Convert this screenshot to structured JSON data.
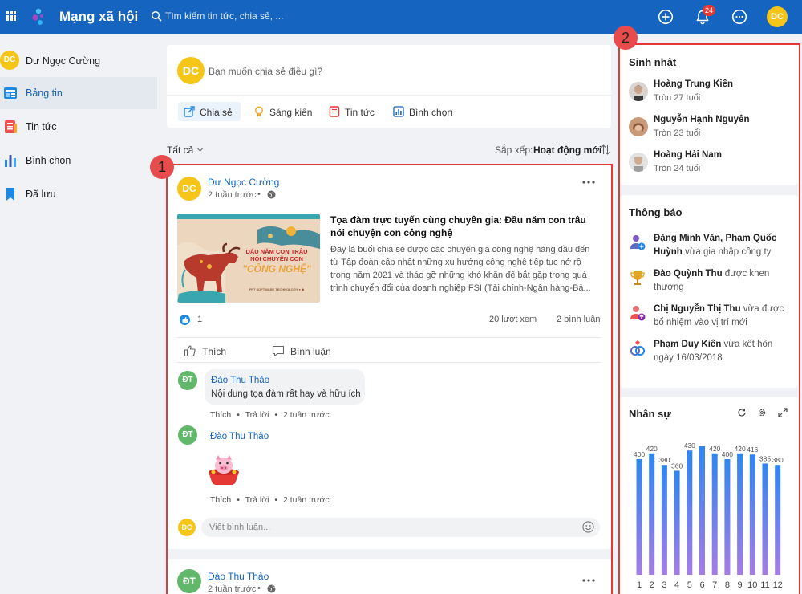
{
  "header": {
    "app_title": "Mạng xã hội",
    "search_placeholder": "Tìm kiếm tin tức, chia sẻ, ...",
    "notification_count": "24",
    "user_initials": "DC",
    "icons": [
      "apps-grid-icon",
      "app-logo-icon",
      "search-icon",
      "add-icon",
      "bell-icon",
      "more-icon"
    ]
  },
  "sidebar": {
    "user": {
      "initials": "DC",
      "name": "Dư Ngọc Cường"
    },
    "items": [
      {
        "label": "Bảng tin",
        "icon": "newsfeed-icon",
        "active": true
      },
      {
        "label": "Tin tức",
        "icon": "news-icon",
        "active": false
      },
      {
        "label": "Bình chọn",
        "icon": "poll-icon",
        "active": false
      },
      {
        "label": "Đã lưu",
        "icon": "bookmark-icon",
        "active": false
      }
    ]
  },
  "composer": {
    "initials": "DC",
    "placeholder": "Bạn muốn chia sẻ điều gì?",
    "actions": [
      {
        "label": "Chia sẻ",
        "icon": "share-icon",
        "active": true
      },
      {
        "label": "Sáng kiến",
        "icon": "idea-icon",
        "active": false
      },
      {
        "label": "Tin tức",
        "icon": "news-icon",
        "active": false
      },
      {
        "label": "Bình chọn",
        "icon": "poll-icon",
        "active": false
      }
    ]
  },
  "filter": {
    "all_label": "Tất cả",
    "sort_label": "Sắp xếp:",
    "sort_value": "Hoạt động mới"
  },
  "callouts": [
    "1",
    "2"
  ],
  "post": {
    "author_initials": "DC",
    "author": "Dư Ngọc Cường",
    "time": "2 tuần trước",
    "dot": "•",
    "article": {
      "image_lines": [
        "DẤU NĂM CON TRÂU",
        "NÓI CHUYỆN CON",
        "\"CÔNG NGHỆ\"",
        "FPT SOFTWARE TECHNOLOGY ● ◆"
      ],
      "title": "Tọa đàm trực tuyến cùng chuyên gia: Đầu năm con trâu nói chuyện con công nghệ",
      "description": "Đây là buổi chia sẻ được các chuyên gia công nghệ hàng đầu đến từ Tập đoàn cập nhật những xu hướng công nghệ tiếp tục nở rộ trong năm 2021 và tháo gỡ những khó khăn để bắt gặp trong quá trình chuyển đổi của doanh nghiệp FSI (Tài chính-Ngân hàng-Bả..."
    },
    "likes": "1",
    "views": "20 lượt xem",
    "comments_count": "2 bình luận",
    "like_label": "Thích",
    "comment_label": "Bình luận",
    "comments": [
      {
        "initials": "ĐT",
        "name": "Đào Thu Thảo",
        "text": "Nội dung tọa đàm rất hay và hữu ích",
        "like": "Thích",
        "reply": "Trả lời",
        "time": "2 tuần trước"
      },
      {
        "initials": "ĐT",
        "name": "Đào Thu Thảo",
        "sticker": "pig-sticker",
        "like": "Thích",
        "reply": "Trả lời",
        "time": "2 tuần trước"
      }
    ],
    "write_initials": "DC",
    "write_placeholder": "Viết bình luận..."
  },
  "post2": {
    "initials": "ĐT",
    "author": "Đào Thu Thảo",
    "time": "2 tuần trước",
    "dot": "•"
  },
  "birthdays": {
    "title": "Sinh nhật",
    "people": [
      {
        "name": "Hoàng Trung Kiên",
        "sub": "Tròn 27 tuổi"
      },
      {
        "name": "Nguyễn Hạnh Nguyên",
        "sub": "Tròn 23 tuổi"
      },
      {
        "name": "Hoàng Hải Nam",
        "sub": "Tròn 24 tuổi"
      }
    ]
  },
  "notices": {
    "title": "Thông báo",
    "items": [
      {
        "icon": "new-member-icon",
        "bold": "Đặng Minh Văn, Phạm Quốc Huỳnh",
        "rest": " vừa gia nhập công ty"
      },
      {
        "icon": "trophy-icon",
        "bold": "Đào Quỳnh Thu",
        "rest": " được khen thưởng"
      },
      {
        "icon": "promotion-icon",
        "bold": "Chị Nguyễn Thị Thu",
        "rest": " vừa được bổ nhiệm vào vị trí mới"
      },
      {
        "icon": "wedding-rings-icon",
        "bold": "Phạm Duy Kiên",
        "rest": " vừa kết hôn ngày 16/03/2018"
      }
    ]
  },
  "staff": {
    "title": "Nhân sự",
    "icons": [
      "refresh-icon",
      "settings-icon",
      "expand-icon"
    ]
  },
  "chart_data": {
    "type": "bar",
    "title": "Nhân sự",
    "categories": [
      "1",
      "2",
      "3",
      "4",
      "5",
      "6",
      "7",
      "8",
      "9",
      "10",
      "11",
      "12"
    ],
    "values": [
      400,
      420,
      380,
      360,
      430,
      null,
      420,
      400,
      420,
      416,
      385,
      380
    ],
    "labels": [
      "400",
      "420",
      "380",
      "360",
      "430",
      "",
      "420",
      "400",
      "420",
      "416",
      "385",
      "380"
    ],
    "ylim": [
      0,
      450
    ],
    "grid": false,
    "legend": "none",
    "colors": {
      "top": "#2e86f0",
      "bottom": "#a57de4"
    }
  }
}
